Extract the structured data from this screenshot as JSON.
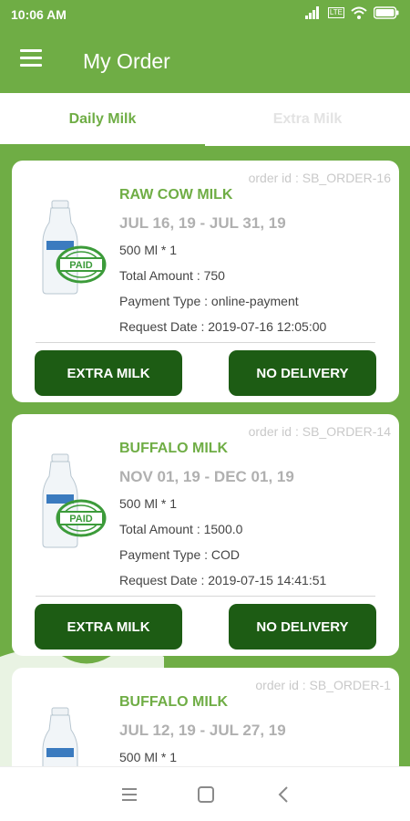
{
  "status_bar": {
    "time": "10:06 AM",
    "volte_label": "LTE",
    "icons": [
      "signal-icon",
      "lte-icon",
      "wifi-icon",
      "battery-icon"
    ]
  },
  "header": {
    "title": "My Order",
    "menu_icon": "hamburger-menu-icon"
  },
  "tabs": [
    {
      "label": "Daily Milk",
      "active": true
    },
    {
      "label": "Extra Milk",
      "active": false
    }
  ],
  "orders": [
    {
      "order_id": "order id : SB_ORDER-16",
      "product": "RAW COW MILK",
      "date_range": "JUL 16, 19 - JUL 31, 19",
      "quantity": "500 Ml * 1",
      "total_amount": "Total Amount  : 750",
      "payment_type": "Payment Type : online-payment",
      "request_date": "Request Date  : 2019-07-16 12:05:00",
      "stamp_text": "PAID",
      "extra_button": "EXTRA MILK",
      "no_delivery_button": "NO DELIVERY"
    },
    {
      "order_id": "order id : SB_ORDER-14",
      "product": "BUFFALO MILK",
      "date_range": "NOV 01, 19 - DEC 01, 19",
      "quantity": "500 Ml * 1",
      "total_amount": "Total Amount  : 1500.0",
      "payment_type": "Payment Type : COD",
      "request_date": "Request Date  : 2019-07-15 14:41:51",
      "stamp_text": "PAID",
      "extra_button": "EXTRA MILK",
      "no_delivery_button": "NO DELIVERY"
    },
    {
      "order_id": "order id : SB_ORDER-1",
      "product": "BUFFALO MILK",
      "date_range": "JUL 12, 19 - JUL 27, 19",
      "quantity": "500 Ml * 1"
    }
  ],
  "colors": {
    "primary": "#6fad45",
    "button": "#1d5c14",
    "muted": "#b0b0b0"
  },
  "nav_bar": {
    "icons": [
      "recent-apps-icon",
      "home-icon",
      "back-icon"
    ]
  }
}
